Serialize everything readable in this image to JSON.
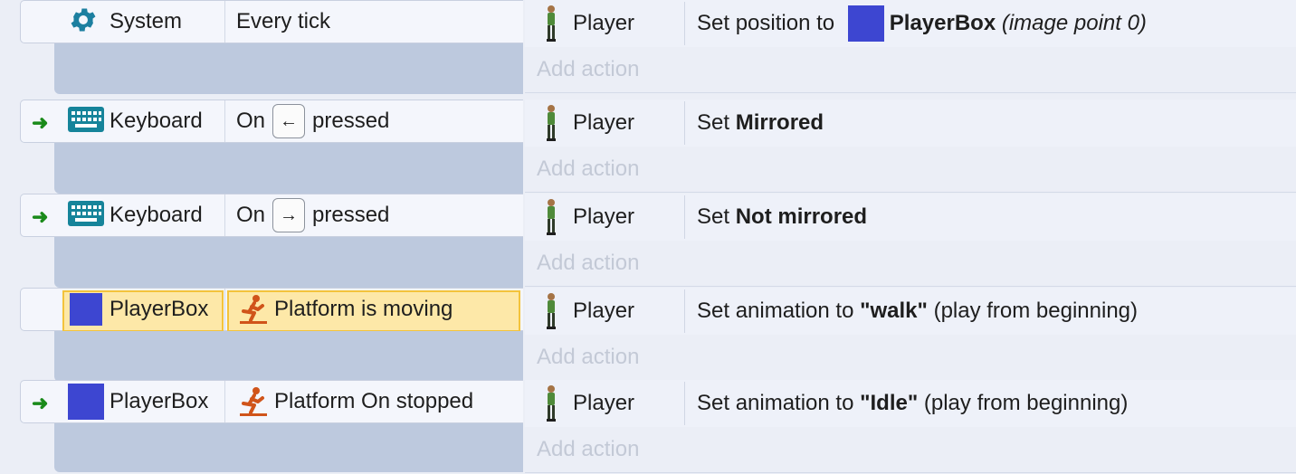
{
  "events": [
    {
      "arrow": false,
      "object": {
        "name": "System",
        "icon": "gear-icon"
      },
      "condition": {
        "text": "Every tick"
      },
      "action": {
        "object": "Player",
        "pre": "Set position to ",
        "bold": "PlayerBox",
        "post": "",
        "italic": "(image point 0)",
        "swatch": true
      },
      "add_action": "Add action"
    },
    {
      "arrow": true,
      "object": {
        "name": "Keyboard",
        "icon": "keyboard-icon"
      },
      "condition": {
        "pre": "On",
        "key": "←",
        "post": "pressed"
      },
      "action": {
        "object": "Player",
        "pre": "Set ",
        "bold": "Mirrored",
        "post": ""
      },
      "add_action": "Add action"
    },
    {
      "arrow": true,
      "object": {
        "name": "Keyboard",
        "icon": "keyboard-icon"
      },
      "condition": {
        "pre": "On",
        "key": "→",
        "post": "pressed"
      },
      "action": {
        "object": "Player",
        "pre": "Set ",
        "bold": "Not mirrored",
        "post": ""
      },
      "add_action": "Add action"
    },
    {
      "arrow": false,
      "highlighted": true,
      "object": {
        "name": "PlayerBox",
        "icon": "blue-square-icon"
      },
      "condition": {
        "text": "Platform is moving",
        "icon": "running-figure-icon"
      },
      "action": {
        "object": "Player",
        "pre": "Set animation to ",
        "bold": "\"walk\"",
        "post": " (play from beginning)"
      },
      "add_action": "Add action"
    },
    {
      "arrow": true,
      "object": {
        "name": "PlayerBox",
        "icon": "blue-square-icon"
      },
      "condition": {
        "text": "Platform On stopped",
        "icon": "running-figure-icon"
      },
      "action": {
        "object": "Player",
        "pre": "Set animation to ",
        "bold": "\"Idle\"",
        "post": " (play from beginning)"
      },
      "add_action": "Add action"
    }
  ],
  "colors": {
    "accent_square": "#3d46d1",
    "condition_highlight": "#fde8a8",
    "platform_icon": "#d0541a",
    "keyboard_icon": "#16849a",
    "gear_icon": "#1c7fa0"
  }
}
